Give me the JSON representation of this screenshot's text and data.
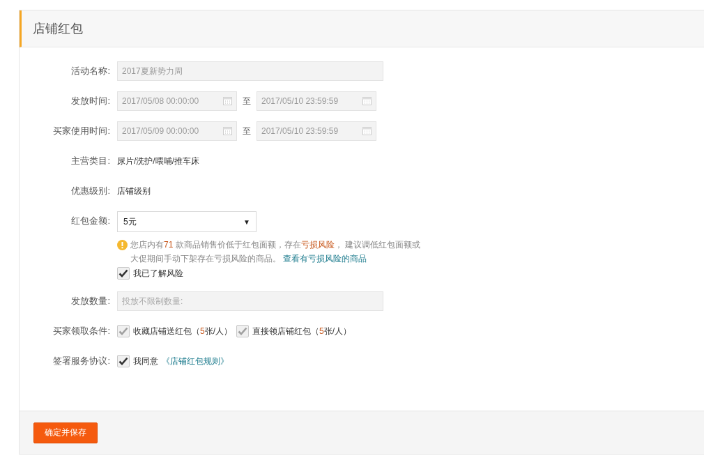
{
  "title": "店铺红包",
  "rows": [
    {
      "kind": "text_input",
      "label": "活动名称:",
      "value": "2017夏新势力周",
      "disabled": true
    },
    {
      "kind": "date_range",
      "label": "发放时间:",
      "start": "2017/05/08 00:00:00",
      "separator": "至",
      "end": "2017/05/10 23:59:59"
    },
    {
      "kind": "date_range",
      "label": "买家使用时间:",
      "start": "2017/05/09 00:00:00",
      "separator": "至",
      "end": "2017/05/10 23:59:59"
    },
    {
      "kind": "text",
      "label": "主营类目:",
      "value": "尿片/洗护/喂哺/推车床"
    },
    {
      "kind": "text",
      "label": "优惠级别:",
      "value": "店铺级别"
    },
    {
      "kind": "select",
      "label": "红包金额:",
      "value": "5元",
      "arrow": "▼",
      "hint": {
        "parts": [
          {
            "text": "您店内有",
            "highlight": false
          },
          {
            "text": "71",
            "highlight": true
          },
          {
            "text": " 款商品销售价低于红包面额，存在",
            "highlight": false
          },
          {
            "text": "亏损风险",
            "highlight": true
          },
          {
            "text": "， 建议调低红包面额或大促期间手动下架存在亏损风险的商品。 ",
            "highlight": false
          }
        ],
        "link": "查看有亏损风险的商品"
      },
      "confirm": {
        "label": "我已了解风险",
        "checked": true,
        "disabled": false
      }
    },
    {
      "kind": "text_input",
      "label": "发放数量:",
      "placeholder": "投放不限制数量:",
      "disabled": true
    },
    {
      "kind": "checkbox_group",
      "label": "买家领取条件:",
      "options": [
        {
          "checked": true,
          "disabled": true,
          "parts": [
            {
              "text": "收藏店铺送红包（",
              "highlight": false
            },
            {
              "text": "5",
              "highlight": true
            },
            {
              "text": "张/人）",
              "highlight": false
            }
          ]
        },
        {
          "checked": true,
          "disabled": true,
          "parts": [
            {
              "text": "直接领店铺红包（",
              "highlight": false
            },
            {
              "text": "5",
              "highlight": true
            },
            {
              "text": "张/人）",
              "highlight": false
            }
          ]
        }
      ]
    },
    {
      "kind": "agreement",
      "label": "签署服务协议:",
      "checked": true,
      "disabled": false,
      "text": "我同意",
      "link": "《店铺红包规则》"
    }
  ],
  "submit": "确定并保存"
}
